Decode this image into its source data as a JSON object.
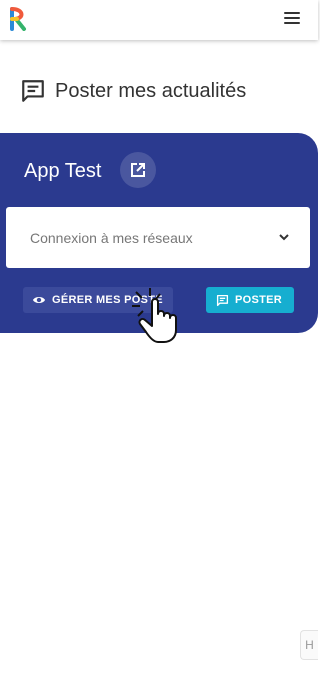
{
  "header": {
    "menu_icon": "hamburger-icon",
    "logo_icon": "r-logo-icon"
  },
  "page": {
    "title": "Poster mes actualités",
    "title_icon": "message-square-icon"
  },
  "card": {
    "title": "App Test",
    "open_icon": "external-link-icon",
    "select": {
      "placeholder": "Connexion à mes réseaux",
      "chevron_icon": "chevron-down-icon"
    },
    "manage_button": {
      "label": "GÉRER MES POSTE",
      "icon": "eye-icon"
    },
    "post_button": {
      "label": "POSTER",
      "icon": "message-square-icon"
    }
  },
  "side_tab": {
    "label": "Н"
  },
  "colors": {
    "card": "#2b3a8f",
    "post_button": "#16aed0",
    "manage_button": "#3b4a9b"
  }
}
